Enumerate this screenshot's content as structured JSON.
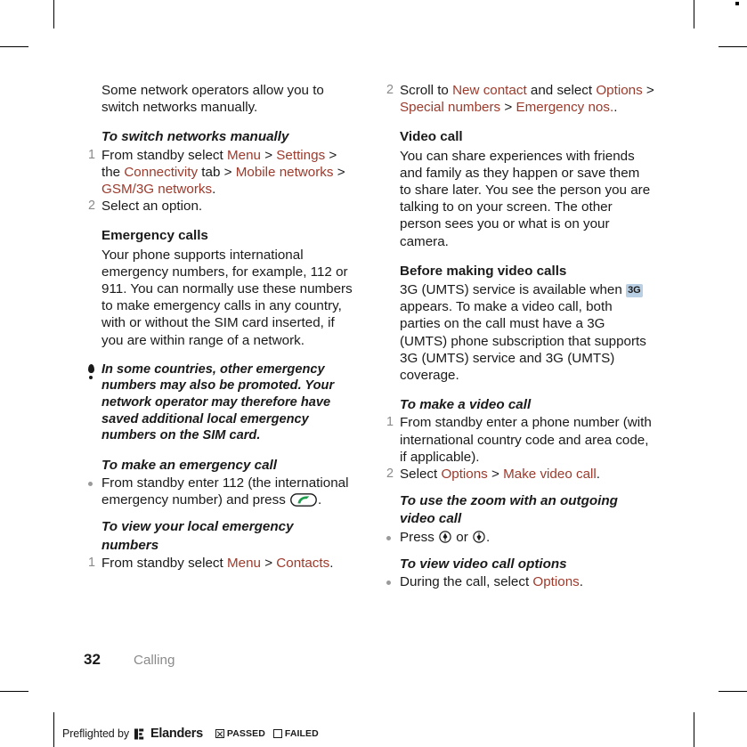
{
  "page": {
    "number": "32",
    "chapter": "Calling"
  },
  "left_column": {
    "intro_paragraph": "Some network operators allow you to switch networks manually.",
    "switch_networks": {
      "heading": "To switch networks manually",
      "steps": [
        {
          "num": "1",
          "parts": [
            {
              "type": "text",
              "value": "From standby select "
            },
            {
              "type": "link",
              "value": "Menu"
            },
            {
              "type": "text",
              "value": " > "
            },
            {
              "type": "link",
              "value": "Settings"
            },
            {
              "type": "text",
              "value": " > the "
            },
            {
              "type": "link",
              "value": "Connectivity"
            },
            {
              "type": "text",
              "value": " tab > "
            },
            {
              "type": "link",
              "value": "Mobile networks"
            },
            {
              "type": "text",
              "value": " > "
            },
            {
              "type": "link",
              "value": "GSM/3G networks"
            },
            {
              "type": "text",
              "value": "."
            }
          ]
        },
        {
          "num": "2",
          "parts": [
            {
              "type": "text",
              "value": "Select an option."
            }
          ]
        }
      ]
    },
    "emergency_calls": {
      "heading": "Emergency calls",
      "body": "Your phone supports international emergency numbers, for example, 112 or 911. You can normally use these numbers to make emergency calls in any country, with or without the SIM card inserted, if you are within range of a network."
    },
    "note": {
      "icon": "exclamation-note-icon",
      "text": "In some countries, other emergency numbers may also be promoted. Your network operator may therefore have saved additional local emergency numbers on the SIM card."
    },
    "make_emergency_call": {
      "heading": "To make an emergency call",
      "bullet_before_icon": "From standby enter 112 (the international emergency number) and press ",
      "bullet_icon": "call-key-icon",
      "bullet_after_icon": "."
    },
    "view_local_emergency": {
      "heading_line1": "To view your local emergency",
      "heading_line2": "numbers",
      "steps": [
        {
          "num": "1",
          "parts": [
            {
              "type": "text",
              "value": "From standby select "
            },
            {
              "type": "link",
              "value": "Menu"
            },
            {
              "type": "text",
              "value": " > "
            },
            {
              "type": "link",
              "value": "Contacts"
            },
            {
              "type": "text",
              "value": "."
            }
          ]
        }
      ]
    }
  },
  "right_column": {
    "continued_step": {
      "num": "2",
      "parts": [
        {
          "type": "text",
          "value": "Scroll to "
        },
        {
          "type": "link",
          "value": "New contact"
        },
        {
          "type": "text",
          "value": " and select "
        },
        {
          "type": "link",
          "value": "Options"
        },
        {
          "type": "text",
          "value": " > "
        },
        {
          "type": "link",
          "value": "Special numbers"
        },
        {
          "type": "text",
          "value": " > "
        },
        {
          "type": "link",
          "value": "Emergency nos."
        },
        {
          "type": "text",
          "value": "."
        }
      ]
    },
    "video_call": {
      "heading": "Video call",
      "body": "You can share experiences with friends and family as they happen or save them to share later. You see the person you are talking to on your screen. The other person sees you or what is on your camera."
    },
    "before_making": {
      "heading": "Before making video calls",
      "body_before_icon": "3G (UMTS) service is available when ",
      "icon_label": "3G",
      "icon_name": "3g-status-badge-icon",
      "body_after_icon": " appears. To make a video call, both parties on the call must have a 3G (UMTS) phone subscription that supports 3G (UMTS) service and 3G (UMTS) coverage."
    },
    "make_video_call": {
      "heading": "To make a video call",
      "steps": [
        {
          "num": "1",
          "parts": [
            {
              "type": "text",
              "value": "From standby enter a phone number (with international country code and area code, if applicable)."
            }
          ]
        },
        {
          "num": "2",
          "parts": [
            {
              "type": "text",
              "value": "Select "
            },
            {
              "type": "link",
              "value": "Options"
            },
            {
              "type": "text",
              "value": " > "
            },
            {
              "type": "link",
              "value": "Make video call"
            },
            {
              "type": "text",
              "value": "."
            }
          ]
        }
      ]
    },
    "zoom_outgoing": {
      "heading_line1": "To use the zoom with an outgoing",
      "heading_line2": "video call",
      "bullet_prefix": "Press ",
      "icon_up": "navigation-key-up-icon",
      "bullet_middle": " or ",
      "icon_down": "navigation-key-down-icon",
      "bullet_suffix": "."
    },
    "view_options": {
      "heading": "To view video call options",
      "bullet_prefix": "During the call, select ",
      "bullet_link": "Options",
      "bullet_suffix": "."
    }
  },
  "preflight": {
    "prefix": "Preflighted by",
    "brand": "Elanders",
    "passed_label": "PASSED",
    "failed_label": "FAILED",
    "passed_checked": true,
    "failed_checked": false
  },
  "colors": {
    "link": "#9c3a2c",
    "text": "#1a1a1a",
    "muted": "#8a8a8a",
    "badge_bg": "#b9cfe3",
    "call_icon_green": "#1f9d4d"
  }
}
